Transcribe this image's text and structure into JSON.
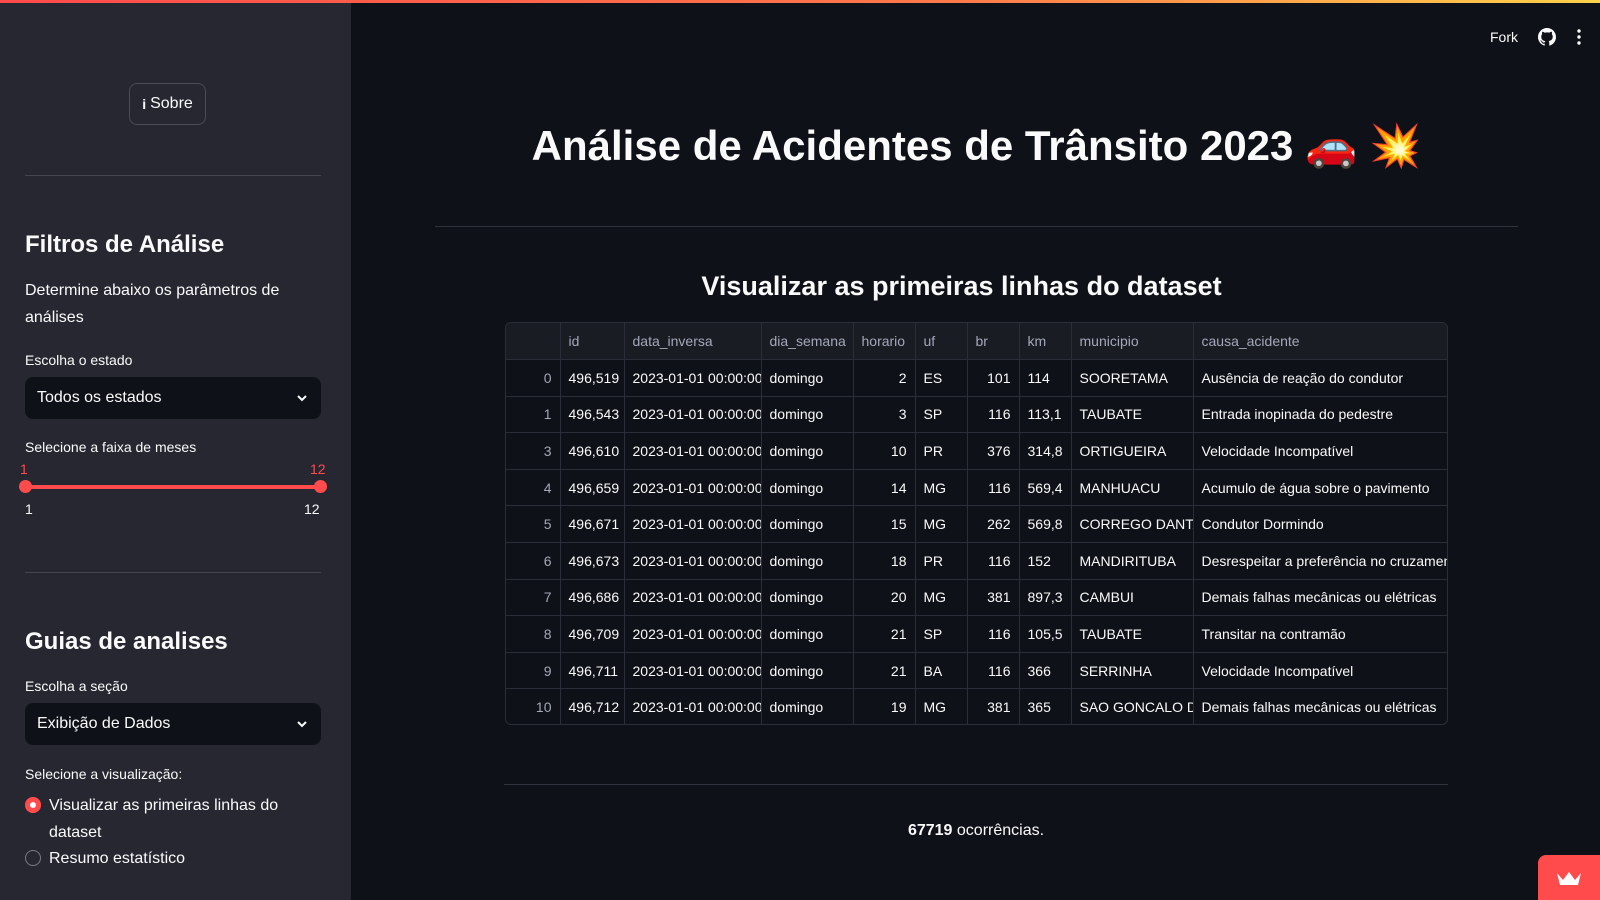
{
  "header": {
    "fork_label": "Fork",
    "github_icon": "github-icon",
    "menu_icon": "kebab-menu-icon"
  },
  "sidebar": {
    "about_button": {
      "icon": "info-icon",
      "label": "Sobre"
    },
    "filters_title": "Filtros de Análise",
    "filters_desc": "Determine abaixo os parâmetros de análises",
    "state_label": "Escolha o estado",
    "state_selected": "Todos os estados",
    "months_label": "Selecione a faixa de meses",
    "months_range": {
      "low": "1",
      "high": "12",
      "min": "1",
      "max": "12"
    },
    "guides_title": "Guias de analises",
    "section_label": "Escolha a seção",
    "section_selected": "Exibição de Dados",
    "viz_label": "Selecione a visualização:",
    "viz_options": [
      {
        "label": "Visualizar as primeiras linhas do dataset",
        "selected": true
      },
      {
        "label": "Resumo estatístico",
        "selected": false
      }
    ]
  },
  "main": {
    "title": "Análise de Acidentes de Trânsito 2023 🚗 💥",
    "subtitle": "Visualizar as primeiras linhas do dataset",
    "table": {
      "columns": [
        "",
        "id",
        "data_inversa",
        "dia_semana",
        "horario",
        "uf",
        "br",
        "km",
        "municipio",
        "causa_acidente"
      ],
      "rows": [
        [
          "0",
          "496,519",
          "2023-01-01 00:00:00",
          "domingo",
          "2",
          "ES",
          "101",
          "114",
          "SOORETAMA",
          "Ausência de reação do condutor"
        ],
        [
          "1",
          "496,543",
          "2023-01-01 00:00:00",
          "domingo",
          "3",
          "SP",
          "116",
          "113,1",
          "TAUBATE",
          "Entrada inopinada do pedestre"
        ],
        [
          "3",
          "496,610",
          "2023-01-01 00:00:00",
          "domingo",
          "10",
          "PR",
          "376",
          "314,8",
          "ORTIGUEIRA",
          "Velocidade Incompatível"
        ],
        [
          "4",
          "496,659",
          "2023-01-01 00:00:00",
          "domingo",
          "14",
          "MG",
          "116",
          "569,4",
          "MANHUACU",
          "Acumulo de água sobre o pavimento"
        ],
        [
          "5",
          "496,671",
          "2023-01-01 00:00:00",
          "domingo",
          "15",
          "MG",
          "262",
          "569,8",
          "CORREGO DANTA",
          "Condutor Dormindo"
        ],
        [
          "6",
          "496,673",
          "2023-01-01 00:00:00",
          "domingo",
          "18",
          "PR",
          "116",
          "152",
          "MANDIRITUBA",
          "Desrespeitar a preferência no cruzamento"
        ],
        [
          "7",
          "496,686",
          "2023-01-01 00:00:00",
          "domingo",
          "20",
          "MG",
          "381",
          "897,3",
          "CAMBUI",
          "Demais falhas mecânicas ou elétricas"
        ],
        [
          "8",
          "496,709",
          "2023-01-01 00:00:00",
          "domingo",
          "21",
          "SP",
          "116",
          "105,5",
          "TAUBATE",
          "Transitar na contramão"
        ],
        [
          "9",
          "496,711",
          "2023-01-01 00:00:00",
          "domingo",
          "21",
          "BA",
          "116",
          "366",
          "SERRINHA",
          "Velocidade Incompatível"
        ],
        [
          "10",
          "496,712",
          "2023-01-01 00:00:00",
          "domingo",
          "19",
          "MG",
          "381",
          "365",
          "SAO GONCALO DO",
          "Demais falhas mecânicas ou elétricas"
        ]
      ]
    },
    "count_value": "67719",
    "count_suffix": " ocorrências."
  },
  "colors": {
    "accent": "#ff4b4b",
    "background": "#0e1117",
    "sidebar": "#262730"
  }
}
